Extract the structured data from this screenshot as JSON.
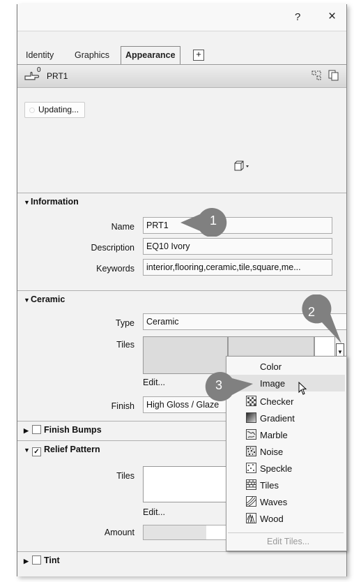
{
  "title_bar": {
    "help": "?",
    "close": "×"
  },
  "tabs": [
    {
      "label": "Identity"
    },
    {
      "label": "Graphics"
    },
    {
      "label": "Appearance"
    }
  ],
  "tab_add": "+",
  "asset": {
    "usage_count": "0",
    "name": "PRT1"
  },
  "preview": {
    "status": "Updating..."
  },
  "information": {
    "header": "Information",
    "name_label": "Name",
    "name_value": "PRT1",
    "description_label": "Description",
    "description_value": "EQ10 Ivory",
    "keywords_label": "Keywords",
    "keywords_value": "interior,flooring,ceramic,tile,square,me..."
  },
  "ceramic": {
    "header": "Ceramic",
    "type_label": "Type",
    "type_value": "Ceramic",
    "tiles_label": "Tiles",
    "edit": "Edit...",
    "finish_label": "Finish",
    "finish_value": "High Gloss / Glaze"
  },
  "finish_bumps": {
    "header": "Finish Bumps"
  },
  "relief_pattern": {
    "header": "Relief Pattern",
    "tiles_label": "Tiles",
    "edit": "Edit...",
    "amount_label": "Amount"
  },
  "tint": {
    "header": "Tint"
  },
  "texture_menu": {
    "items": [
      {
        "label": "Color",
        "icon": "none"
      },
      {
        "label": "Image",
        "icon": "none"
      },
      {
        "label": "Checker",
        "icon": "checker-icon"
      },
      {
        "label": "Gradient",
        "icon": "gradient-icon"
      },
      {
        "label": "Marble",
        "icon": "marble-icon"
      },
      {
        "label": "Noise",
        "icon": "noise-icon"
      },
      {
        "label": "Speckle",
        "icon": "speckle-icon"
      },
      {
        "label": "Tiles",
        "icon": "tiles-icon"
      },
      {
        "label": "Waves",
        "icon": "waves-icon"
      },
      {
        "label": "Wood",
        "icon": "wood-icon"
      }
    ],
    "edit_tiles": "Edit Tiles..."
  },
  "callouts": [
    "1",
    "2",
    "3"
  ],
  "colors": {
    "callout": "#808080",
    "panel": "#f2f2f2",
    "highlight": "#e2e2e2"
  }
}
